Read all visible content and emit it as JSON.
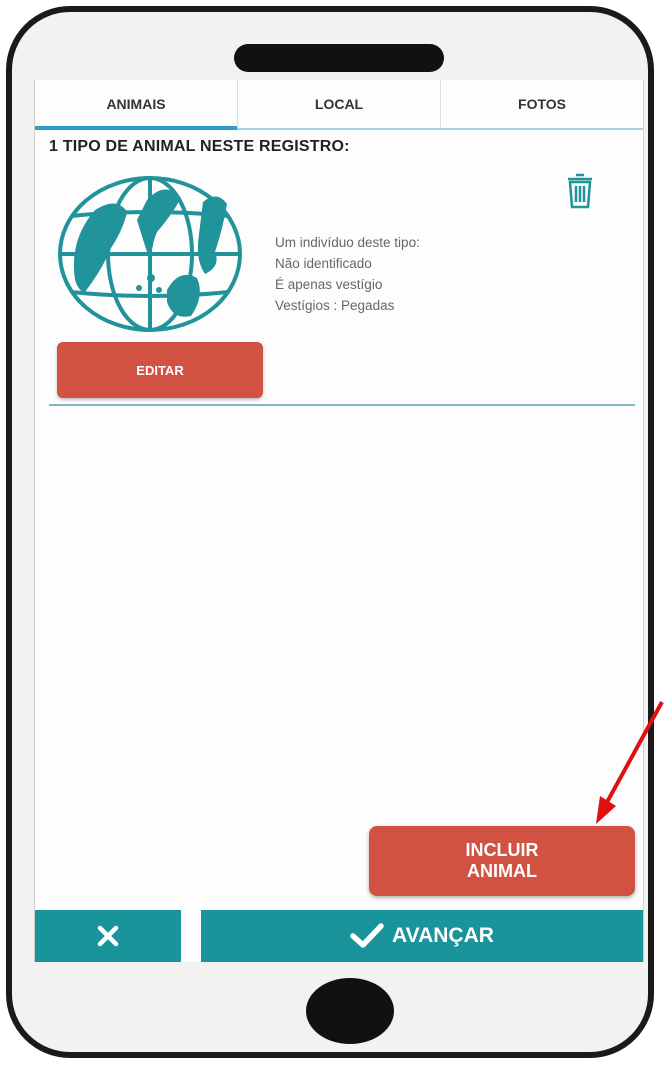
{
  "tabs": [
    {
      "label": "ANIMAIS",
      "active": true
    },
    {
      "label": "LOCAL",
      "active": false
    },
    {
      "label": "FOTOS",
      "active": false
    }
  ],
  "heading": "1 TIPO DE ANIMAL NESTE REGISTRO:",
  "animal_card": {
    "icon": "animals-globe-logo",
    "delete_icon": "trash-icon",
    "lines": [
      "Um indivíduo deste tipo:",
      "Não identificado",
      "É apenas vestígio",
      "Vestígios : Pegadas"
    ],
    "edit_label": "EDITAR"
  },
  "include_button": {
    "line1": "INCLUIR",
    "line2": "ANIMAL"
  },
  "bottom_bar": {
    "close_icon": "close-icon",
    "next_icon": "check-icon",
    "next_label": "AVANÇAR"
  },
  "annotation": {
    "icon": "red-arrow-icon"
  },
  "colors": {
    "accent": "#2c9ec4",
    "teal": "#19949b",
    "button_red": "#d15142",
    "logo_teal": "#21949b",
    "annotation_red": "#e01010"
  }
}
